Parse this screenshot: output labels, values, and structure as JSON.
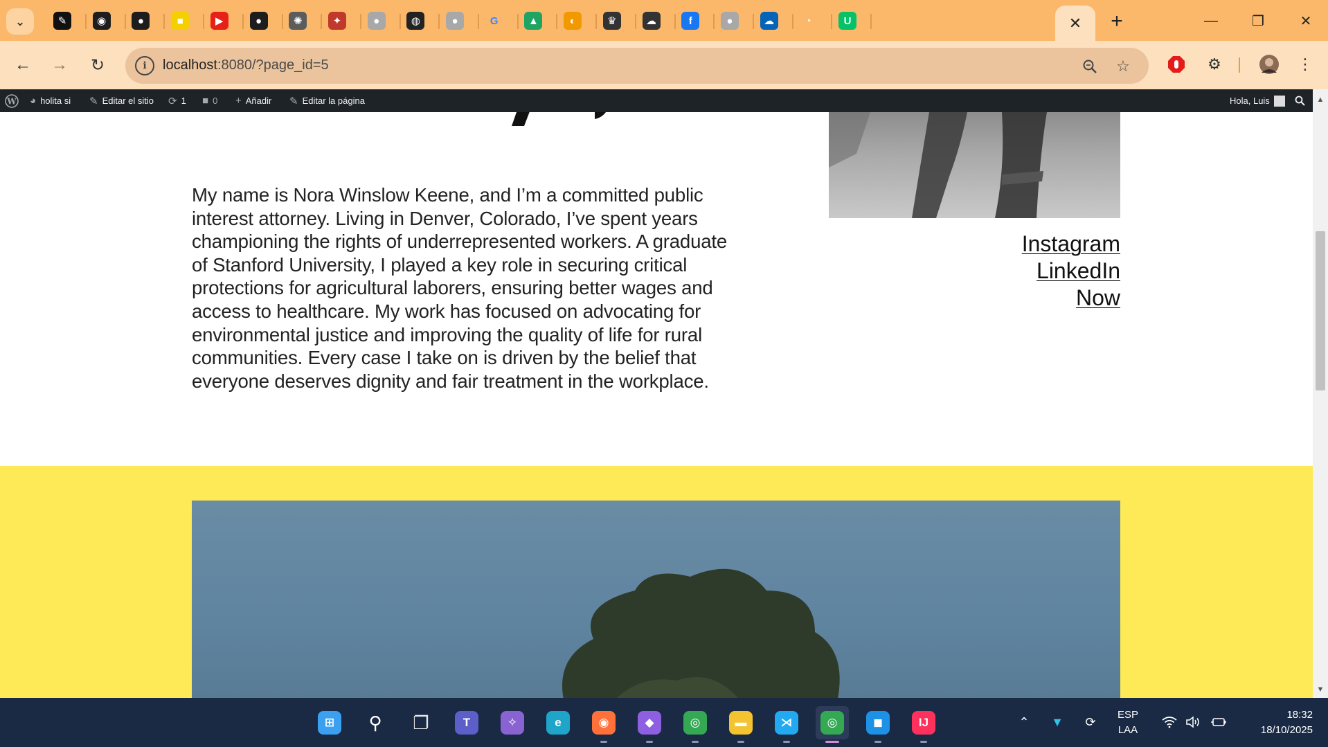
{
  "browser": {
    "tabs": [
      {
        "icon": "pen-icon",
        "color": "#111111"
      },
      {
        "icon": "podcast-icon",
        "color": "#1d1d1d"
      },
      {
        "icon": "github-icon",
        "color": "#1d1d1d"
      },
      {
        "icon": "note-icon",
        "color": "#f5d000"
      },
      {
        "icon": "youtube-icon",
        "color": "#e62117"
      },
      {
        "icon": "github-icon",
        "color": "#1d1d1d"
      },
      {
        "icon": "openai-icon",
        "color": "#5c5c5c"
      },
      {
        "icon": "puzzle-icon",
        "color": "#c0392b"
      },
      {
        "icon": "globe-icon",
        "color": "#a8a8a8"
      },
      {
        "icon": "mask-icon",
        "color": "#222222"
      },
      {
        "icon": "globe-icon",
        "color": "#a8a8a8"
      },
      {
        "icon": "google-icon",
        "color": "#4285f4"
      },
      {
        "icon": "drive-icon",
        "color": "#1fa463"
      },
      {
        "icon": "toggle-icon",
        "color": "#f29900"
      },
      {
        "icon": "shield-crest-icon",
        "color": "#333333"
      },
      {
        "icon": "cloud-download-icon",
        "color": "#333333"
      },
      {
        "icon": "facebook-icon",
        "color": "#1877f2"
      },
      {
        "icon": "globe-icon",
        "color": "#a8a8a8"
      },
      {
        "icon": "onedrive-icon",
        "color": "#0364b8"
      },
      {
        "icon": "chat-icon",
        "color": "#ffffff"
      },
      {
        "icon": "ubereats-icon",
        "color": "#06c167"
      }
    ],
    "url": "localhost",
    "url_path": ":8080/?page_id=5"
  },
  "adminbar": {
    "site_name": "holita si",
    "edit_site": "Editar el sitio",
    "updates_count": "1",
    "comments_count": "0",
    "add_new": "Añadir",
    "edit_page": "Editar la página",
    "greeting": "Hola, Luis"
  },
  "page": {
    "bio": "My name is Nora Winslow Keene, and I’m a committed public interest attorney. Living in Denver, Colorado, I’ve spent years championing the rights of underrepresented workers. A graduate of Stanford University, I played a key role in securing critical protections for agricultural laborers, ensuring better wages and access to healthcare. My work has focused on advocating for environmental justice and improving the quality of life for rural communities. Every case I take on is driven by the belief that everyone deserves dignity and fair treatment in the workplace.",
    "links": [
      "Instagram",
      "LinkedIn",
      "Now"
    ],
    "band_color": "#fdea56"
  },
  "taskbar": {
    "apps": [
      {
        "icon": "windows-start-icon",
        "color": "#3ba0f0"
      },
      {
        "icon": "search-icon",
        "color": "#ffffff"
      },
      {
        "icon": "task-view-icon",
        "color": "#e6e6e6"
      },
      {
        "icon": "teams-icon",
        "color": "#5b5fc7"
      },
      {
        "icon": "copilot-icon",
        "color": "#8a63d2"
      },
      {
        "icon": "edge-icon",
        "color": "#1ea5c9"
      },
      {
        "icon": "firefox-icon",
        "color": "#ff7139"
      },
      {
        "icon": "obsidian-icon",
        "color": "#8e5fe0"
      },
      {
        "icon": "chrome-icon",
        "color": "#34a853"
      },
      {
        "icon": "file-explorer-icon",
        "color": "#f4c430"
      },
      {
        "icon": "vscode-icon",
        "color": "#23a9f2"
      },
      {
        "icon": "chrome-profile-icon",
        "color": "#34a853"
      },
      {
        "icon": "docker-icon",
        "color": "#1d91e6"
      },
      {
        "icon": "intellij-icon",
        "color": "#fe315d"
      }
    ],
    "language_top": "ESP",
    "language_bottom": "LAA",
    "time": "18:32",
    "date": "18/10/2025"
  }
}
